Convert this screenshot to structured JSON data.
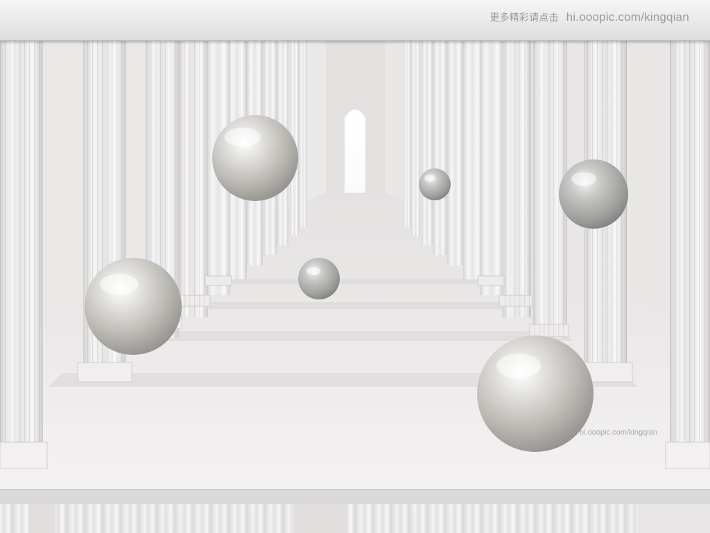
{
  "header": {
    "caption_cn": "更多精彩请点击",
    "caption_url": "hi.ooopic.com/kingqian"
  },
  "scene": {
    "watermark": "hi.ooopic.com/kingqian"
  },
  "colors": {
    "marble": "#f2f0f0",
    "sphere_light": "#ffffff",
    "sphere_dark": "#9a9a96",
    "doorway": "#ffffff"
  }
}
